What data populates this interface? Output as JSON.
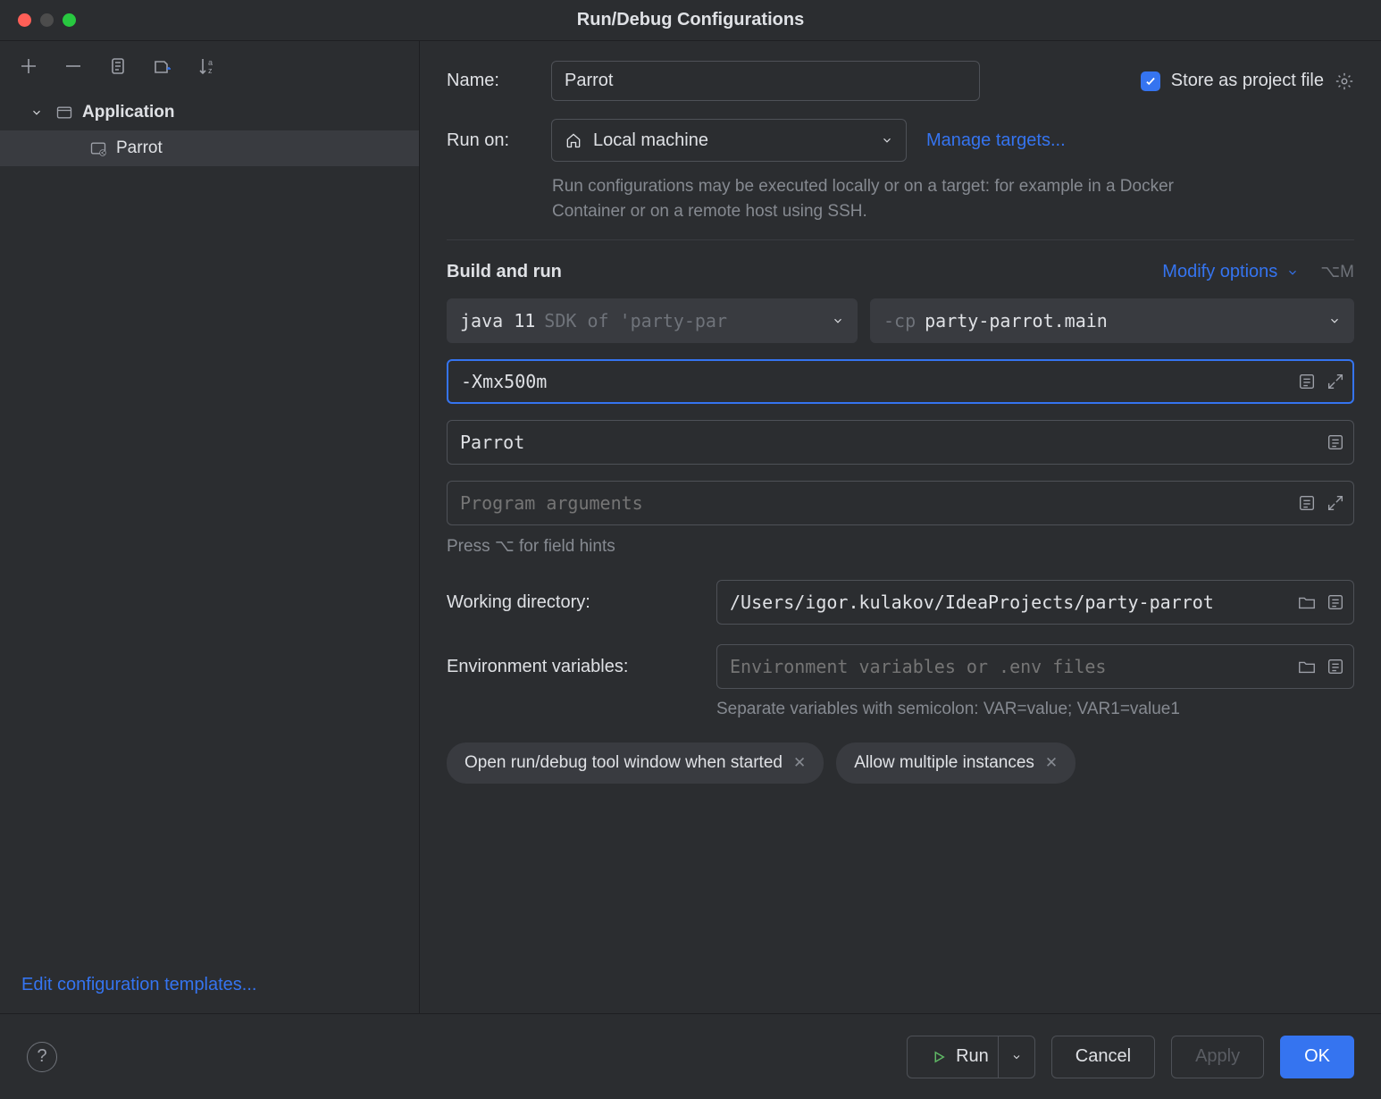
{
  "title": "Run/Debug Configurations",
  "sidebar": {
    "group": "Application",
    "item": "Parrot",
    "footer_link": "Edit configuration templates..."
  },
  "form": {
    "name_label": "Name:",
    "name_value": "Parrot",
    "store_label": "Store as project file",
    "runon_label": "Run on:",
    "runon_value": "Local machine",
    "manage_targets": "Manage targets...",
    "runon_hint": "Run configurations may be executed locally or on a target: for example in a Docker Container or on a remote host using SSH.",
    "section_title": "Build and run",
    "modify_options": "Modify options",
    "modify_shortcut": "⌥M",
    "jdk_value": "java 11",
    "jdk_hint": "SDK of 'party-par",
    "cp_prefix": "-cp",
    "cp_value": "party-parrot.main",
    "vm_options": "-Xmx500m",
    "main_class": "Parrot",
    "prog_args_placeholder": "Program arguments",
    "field_hint": "Press ⌥ for field hints",
    "workdir_label": "Working directory:",
    "workdir_value": "/Users/igor.kulakov/IdeaProjects/party-parrot",
    "env_label": "Environment variables:",
    "env_placeholder": "Environment variables or .env files",
    "env_hint": "Separate variables with semicolon: VAR=value; VAR1=value1",
    "tag1": "Open run/debug tool window when started",
    "tag2": "Allow multiple instances"
  },
  "footer": {
    "run": "Run",
    "cancel": "Cancel",
    "apply": "Apply",
    "ok": "OK"
  }
}
